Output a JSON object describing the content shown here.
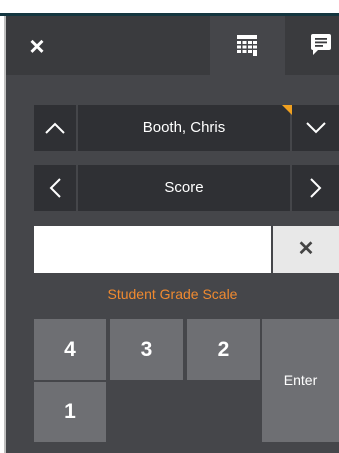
{
  "header": {
    "close_label": "×",
    "tabs": [
      {
        "name": "grid-tab",
        "icon": "grid-icon",
        "active": true
      },
      {
        "name": "comment-tab",
        "icon": "comment-icon",
        "active": false
      }
    ]
  },
  "student_nav": {
    "student_name": "Booth, Chris",
    "prev_icon": "chevron-up-icon",
    "next_icon": "chevron-down-icon"
  },
  "field_nav": {
    "field_label": "Score",
    "prev_icon": "chevron-left-icon",
    "next_icon": "chevron-right-icon"
  },
  "score_entry": {
    "value": "",
    "clear_label": "✕"
  },
  "grade_scale_link": "Student Grade Scale",
  "keypad": {
    "keys": [
      "4",
      "3",
      "2",
      "1"
    ],
    "enter_label": "Enter"
  },
  "colors": {
    "panel": "#45464a",
    "button_dark": "#2f3034",
    "key": "#6e6f73",
    "accent_orange": "#f08a30",
    "flag": "#f0a020"
  }
}
